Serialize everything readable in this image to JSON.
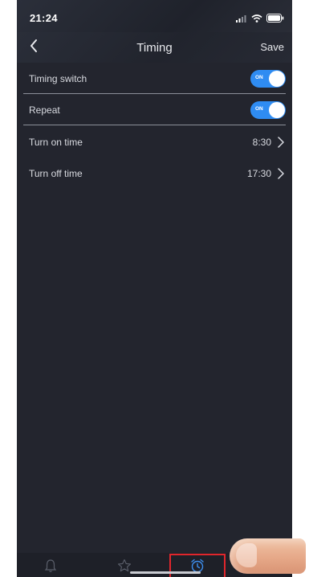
{
  "status_bar": {
    "time": "21:24",
    "icons": [
      "signal-icon",
      "wifi-icon",
      "battery-icon"
    ]
  },
  "header": {
    "back_icon": "chevron-left-icon",
    "title": "Timing",
    "save_label": "Save"
  },
  "settings": {
    "timing_switch": {
      "label": "Timing switch",
      "state_text": "ON",
      "on": true
    },
    "repeat": {
      "label": "Repeat",
      "state_text": "ON",
      "on": true
    },
    "turn_on_time": {
      "label": "Turn on time",
      "value": "8:30"
    },
    "turn_off_time": {
      "label": "Turn off time",
      "value": "17:30"
    }
  },
  "tab_bar": {
    "tabs": [
      {
        "icon": "bell-icon"
      },
      {
        "icon": "star-icon"
      },
      {
        "icon": "alarm-clock-icon",
        "highlighted": true
      }
    ]
  },
  "colors": {
    "background": "#23252e",
    "accent": "#2f8cf2",
    "highlight": "#e0262c"
  }
}
